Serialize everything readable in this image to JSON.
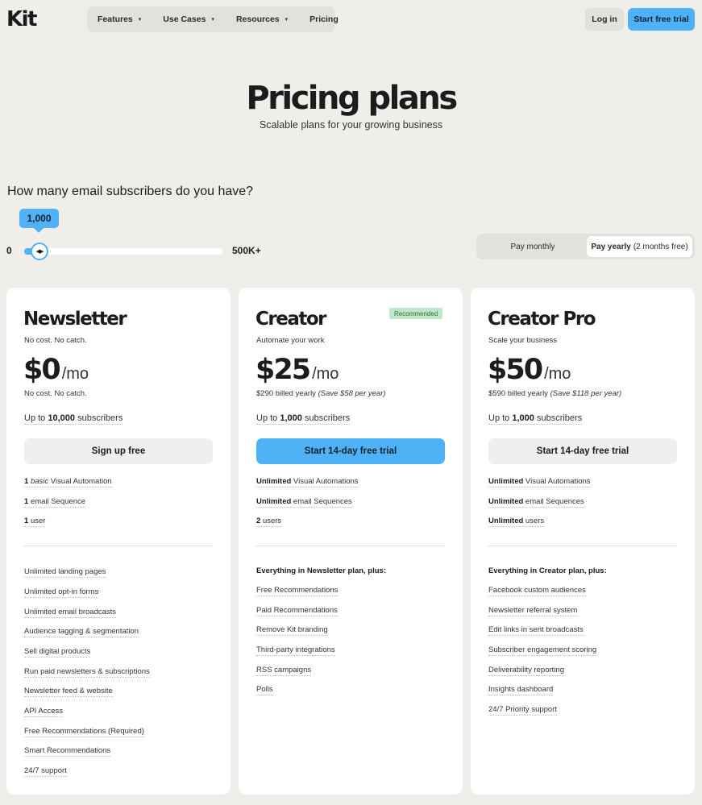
{
  "nav": {
    "logo": "Kit",
    "menu": [
      {
        "label": "Features",
        "caret": "▾"
      },
      {
        "label": "Use Cases",
        "caret": "▾"
      },
      {
        "label": "Resources",
        "caret": "▾"
      },
      {
        "label": "Pricing"
      }
    ],
    "login_label": "Log in",
    "trial_label": "Start free trial"
  },
  "hero": {
    "title": "Pricing plans",
    "subtitle": "Scalable plans for your growing business"
  },
  "slider": {
    "question": "How many email subscribers do you have?",
    "value_label": "1,000",
    "min_label": "0",
    "max_label": "500K+",
    "thumb_glyph": "◀▶",
    "fill_fraction": 0.07
  },
  "billing_toggle": {
    "monthly_label": "Pay monthly",
    "yearly_label": "Pay yearly",
    "yearly_note": "(2 months free)",
    "selected": "yearly"
  },
  "colors": {
    "accent": "#4fb2f7",
    "background": "#f0eeea",
    "badge_bg": "#bfe8c8"
  },
  "plans": [
    {
      "name": "Newsletter",
      "tagline": "No cost. No catch.",
      "price": "$0",
      "unit": "/mo",
      "billing": "No cost. No catch.",
      "billing_note": "",
      "subs_prefix": "Up to",
      "subs_count": "10,000",
      "subs_suffix": "subscribers",
      "cta": "Sign up free",
      "core": [
        {
          "strong": "1",
          "em": "basic",
          "text": "Visual Automation"
        },
        {
          "strong": "1",
          "text": "email Sequence"
        },
        {
          "strong": "1",
          "text": "user"
        }
      ],
      "extras_heading": "",
      "extras": [
        "Unlimited landing pages",
        "Unlimited opt-in forms",
        "Unlimited email broadcasts",
        "Audience tagging & segmentation",
        "Sell digital products",
        "Run paid newsletters & subscriptions",
        "Newsletter feed & website",
        "API Access",
        "Free Recommendations (Required)",
        "Smart Recommendations",
        "24/7 support"
      ]
    },
    {
      "name": "Creator",
      "badge": "Recommended",
      "tagline": "Automate your work",
      "price": "$25",
      "unit": "/mo",
      "billing": "$290 billed yearly",
      "billing_note": "(Save $58 per year)",
      "subs_prefix": "Up to",
      "subs_count": "1,000",
      "subs_suffix": "subscribers",
      "cta": "Start 14-day free trial",
      "core": [
        {
          "strong": "Unlimited",
          "text": "Visual Automations"
        },
        {
          "strong": "Unlimited",
          "text": "email Sequences"
        },
        {
          "strong": "2",
          "text": "users"
        }
      ],
      "extras_heading": "Everything in Newsletter plan, plus:",
      "extras": [
        "Free Recommendations",
        "Paid Recommendations",
        "Remove Kit branding",
        "Third-party integrations",
        "RSS campaigns",
        "Polls"
      ]
    },
    {
      "name": "Creator Pro",
      "tagline": "Scale your business",
      "price": "$50",
      "unit": "/mo",
      "billing": "$590 billed yearly",
      "billing_note": "(Save $118 per year)",
      "subs_prefix": "Up to",
      "subs_count": "1,000",
      "subs_suffix": "subscribers",
      "cta": "Start 14-day free trial",
      "core": [
        {
          "strong": "Unlimited",
          "text": "Visual Automations"
        },
        {
          "strong": "Unlimited",
          "text": "email Sequences"
        },
        {
          "strong": "Unlimited",
          "text": "users"
        }
      ],
      "extras_heading": "Everything in Creator plan, plus:",
      "extras": [
        "Facebook custom audiences",
        "Newsletter referral system",
        "Edit links in sent broadcasts",
        "Subscriber engagement scoring",
        "Deliverability reporting",
        "Insights dashboard",
        "24/7 Priority support"
      ]
    }
  ]
}
